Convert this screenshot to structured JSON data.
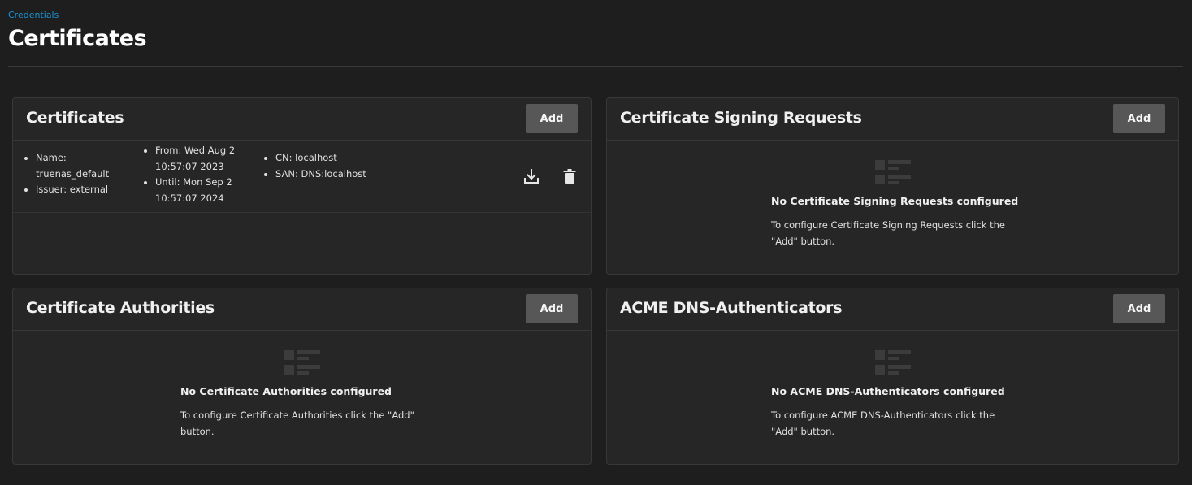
{
  "breadcrumb": "Credentials",
  "page_title": "Certificates",
  "cards": {
    "certificates": {
      "title": "Certificates",
      "add_label": "Add",
      "row": {
        "col1": [
          "Name: truenas_default",
          "Issuer: external"
        ],
        "col2": [
          "From: Wed Aug 2 10:57:07 2023",
          "Until: Mon Sep 2 10:57:07 2024"
        ],
        "col3": [
          "CN: localhost",
          "SAN: DNS:localhost"
        ],
        "download_icon": "download-icon",
        "delete_icon": "trash-icon"
      }
    },
    "csr": {
      "title": "Certificate Signing Requests",
      "add_label": "Add",
      "empty_title": "No Certificate Signing Requests configured",
      "empty_text": "To configure Certificate Signing Requests click the \"Add\" button."
    },
    "ca": {
      "title": "Certificate Authorities",
      "add_label": "Add",
      "empty_title": "No Certificate Authorities configured",
      "empty_text": "To configure Certificate Authorities click the \"Add\" button."
    },
    "acme": {
      "title": "ACME DNS-Authenticators",
      "add_label": "Add",
      "empty_title": "No ACME DNS-Authenticators configured",
      "empty_text": "To configure ACME DNS-Authenticators click the \"Add\" button."
    }
  },
  "colors": {
    "background": "#1e1e1e",
    "card": "#262626",
    "button": "#575757",
    "link": "#1a93d6"
  }
}
